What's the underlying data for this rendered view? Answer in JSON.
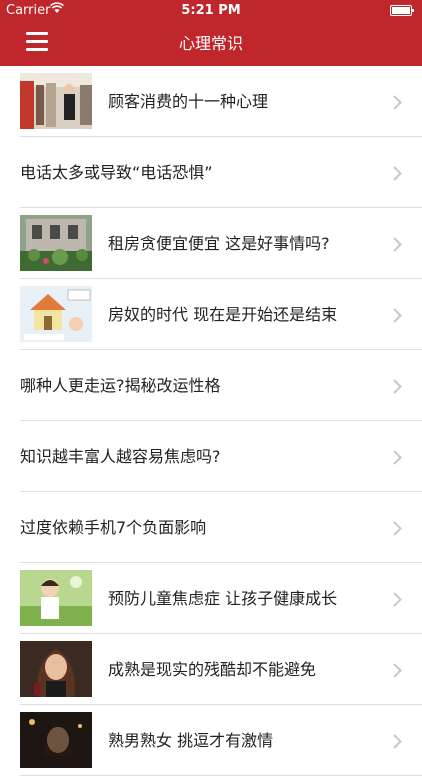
{
  "status_bar": {
    "carrier": "Carrier",
    "time": "5:21 PM"
  },
  "header": {
    "title": "心理常识",
    "accent_color": "#c0272d"
  },
  "items": [
    {
      "label": "顾客消费的十一种心理",
      "has_image": true
    },
    {
      "label": "电话太多或导致“电话恐惧”",
      "has_image": false
    },
    {
      "label": "租房贪便宜便宜 这是好事情吗?",
      "has_image": true
    },
    {
      "label": "房奴的时代 现在是开始还是结束",
      "has_image": true
    },
    {
      "label": "哪种人更走运?揭秘改运性格",
      "has_image": false
    },
    {
      "label": "知识越丰富人越容易焦虑吗?",
      "has_image": false
    },
    {
      "label": "过度依赖手机7个负面影响",
      "has_image": false
    },
    {
      "label": "预防儿童焦虑症 让孩子健康成长",
      "has_image": true
    },
    {
      "label": "成熟是现实的残酷却不能避免",
      "has_image": true
    },
    {
      "label": "熟男熟女 挑逗才有激情",
      "has_image": true
    }
  ]
}
